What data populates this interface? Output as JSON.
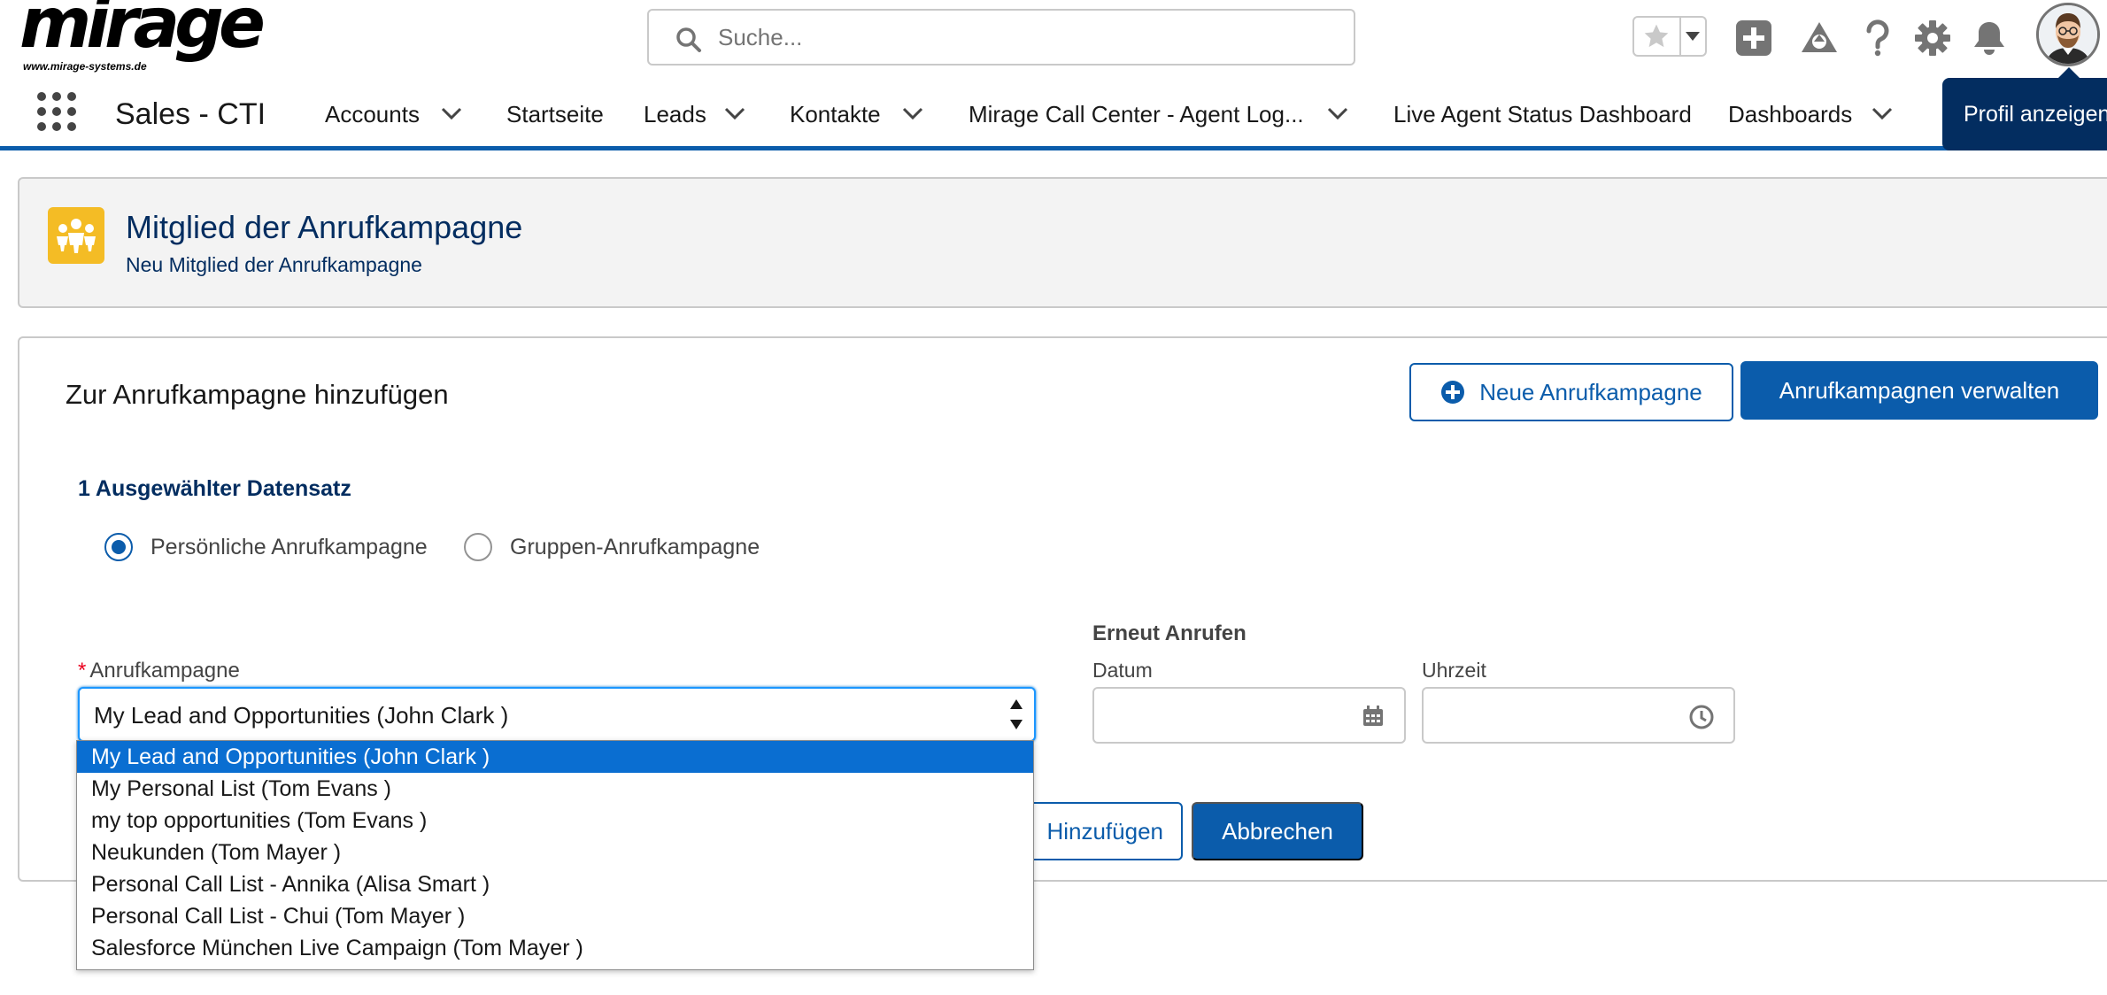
{
  "header": {
    "logo_text": "mirage",
    "logo_url": "www.mirage-systems.de",
    "search_placeholder": "Suche..."
  },
  "nav": {
    "app_name": "Sales - CTI",
    "items": [
      {
        "label": "Accounts",
        "has_menu": true
      },
      {
        "label": "Startseite",
        "has_menu": false
      },
      {
        "label": "Leads",
        "has_menu": true
      },
      {
        "label": "Kontakte",
        "has_menu": true
      },
      {
        "label": "Mirage Call Center - Agent Log...",
        "has_menu": true
      },
      {
        "label": "Live Agent Status Dashboard",
        "has_menu": false
      },
      {
        "label": "Dashboards",
        "has_menu": true
      }
    ],
    "tooltip": "Profil anzeigen"
  },
  "page_header": {
    "title": "Mitglied der Anrufkampagne",
    "subtitle": "Neu Mitglied der Anrufkampagne"
  },
  "card": {
    "title": "Zur Anrufkampagne hinzufügen",
    "new_button": "Neue Anrufkampagne",
    "manage_button": "Anrufkampagnen verwalten",
    "selected_count": "1 Ausgewählter Datensatz",
    "radio_personal": "Persönliche Anrufkampagne",
    "radio_group": "Gruppen-Anrufkampagne",
    "required_mark": "*",
    "campaign_label": "Anrufkampagne",
    "campaign_value": "My Lead and Opportunities (John Clark )",
    "callback_heading": "Erneut Anrufen",
    "date_label": "Datum",
    "time_label": "Uhrzeit",
    "add_button": "Hinzufügen",
    "cancel_button": "Abbrechen"
  },
  "dropdown": {
    "options": [
      "My Lead and Opportunities (John Clark )",
      "My Personal List (Tom Evans )",
      "my top opportunities (Tom Evans )",
      "Neukunden (Tom Mayer )",
      "Personal Call List - Annika (Alisa Smart )",
      "Personal Call List - Chui (Tom Mayer )",
      "Salesforce München Live Campaign (Tom Mayer )"
    ],
    "selected_index": 0
  },
  "colors": {
    "brand": "#0b5cab",
    "nav_underline": "#0b5cab",
    "object_icon": "#f4bc25",
    "tooltip_bg": "#032d60",
    "selected_option": "#0a6ed1"
  }
}
